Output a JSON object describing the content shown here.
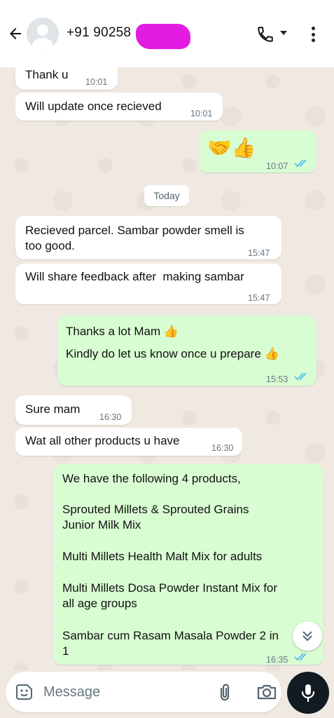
{
  "header": {
    "contact": "+91 90258",
    "icons": {
      "back": "arrow-left-icon",
      "avatar": "default-avatar-icon",
      "call": "phone-icon",
      "menu": "more-vert-icon"
    }
  },
  "day_separator": "Today",
  "messages": [
    {
      "dir": "in",
      "text": "Thank u",
      "time": "10:01"
    },
    {
      "dir": "in",
      "text": "Will update once recieved",
      "time": "10:01"
    },
    {
      "dir": "out",
      "text": "🤝👍",
      "time": "10:07",
      "status": "read"
    },
    {
      "dir": "in",
      "text_lines": [
        "Recieved parcel. Sambar powder smell is",
        "too good."
      ],
      "time": "15:47"
    },
    {
      "dir": "in",
      "text": "Will share feedback after  making sambar",
      "time": "15:47"
    },
    {
      "dir": "out",
      "text_lines": [
        "Thanks a lot Mam 👍",
        "Kindly do let us know once u prepare 👍"
      ],
      "time": "15:53",
      "status": "read"
    },
    {
      "dir": "in",
      "text": "Sure mam",
      "time": "16:30"
    },
    {
      "dir": "in",
      "text": "Wat all other products u have",
      "time": "16:30"
    },
    {
      "dir": "out",
      "text_lines": [
        "We have the following 4 products,",
        "",
        "Sprouted Millets & Sprouted Grains",
        "Junior Milk Mix",
        "",
        "Multi Millets Health Malt Mix for adults",
        "",
        "Multi Millets Dosa Powder Instant Mix for",
        "all age groups",
        "",
        "Sambar cum Rasam Masala Powder 2 in",
        "1"
      ],
      "time": "16:35",
      "status": "read"
    }
  ],
  "composer": {
    "placeholder": "Message",
    "icons": {
      "sticker": "sticker-icon",
      "attach": "paperclip-icon",
      "camera": "camera-icon",
      "mic": "mic-icon"
    }
  },
  "colors": {
    "incoming": "#ffffff",
    "outgoing": "#d9fdd3",
    "read_ticks": "#53bdeb",
    "wallpaper": "#efe9e1"
  }
}
